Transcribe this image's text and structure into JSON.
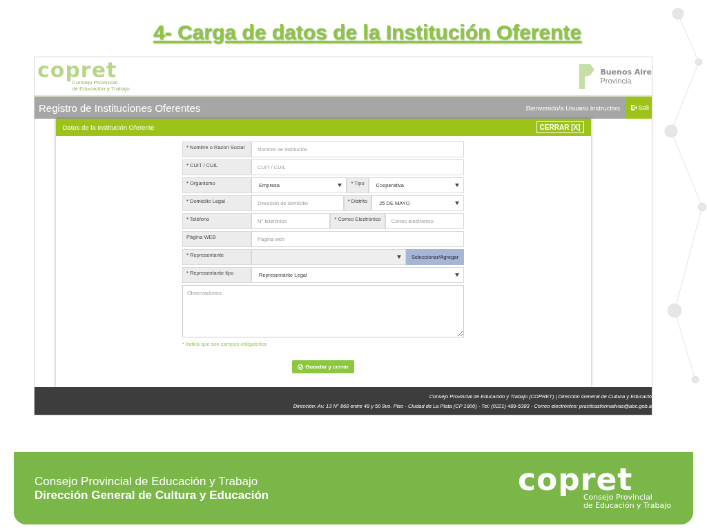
{
  "slide_title": "4- Carga de datos de la Institución Oferente",
  "app": {
    "logo": {
      "word": "copret",
      "line1": "Consejo Provincial",
      "line2": "de Educación y Trabajo"
    },
    "gov_logo": {
      "line1": "Buenos Aire",
      "line2": "Provincia"
    },
    "nav": {
      "title": "Registro de Instituciones Oferentes",
      "welcome": "Bienvenido/a Usuario Instructivo",
      "logout": "Sali"
    },
    "modal": {
      "title": "Datos de la Institución Oferente",
      "close": "CERRAR [X]",
      "rows": [
        {
          "items": [
            {
              "kind": "label",
              "text": "* Nombre o Razon Social"
            },
            {
              "kind": "input",
              "placeholder": "Nombre de institución"
            }
          ]
        },
        {
          "items": [
            {
              "kind": "label",
              "text": "* CUIT / CUIL"
            },
            {
              "kind": "input",
              "placeholder": "CUIT / CUIL"
            }
          ]
        },
        {
          "items": [
            {
              "kind": "label",
              "text": "* Organismo"
            },
            {
              "kind": "select",
              "value": "Empresa"
            },
            {
              "kind": "label",
              "text": "* Tipo"
            },
            {
              "kind": "select",
              "value": "Cooperativa"
            }
          ]
        },
        {
          "items": [
            {
              "kind": "label",
              "text": "* Domicilio Legal"
            },
            {
              "kind": "input",
              "placeholder": "Dirección de domicilio"
            },
            {
              "kind": "label",
              "text": "* Distrito"
            },
            {
              "kind": "select",
              "value": "25 DE MAYO"
            }
          ]
        },
        {
          "items": [
            {
              "kind": "label",
              "text": "* Teléfono"
            },
            {
              "kind": "input",
              "placeholder": "N° telefónico"
            },
            {
              "kind": "label",
              "text": "* Correo Electrónico"
            },
            {
              "kind": "input",
              "placeholder": "Correo electronico"
            }
          ]
        },
        {
          "items": [
            {
              "kind": "label",
              "text": "Página WEB"
            },
            {
              "kind": "input",
              "placeholder": "Pagina web"
            }
          ]
        },
        {
          "items": [
            {
              "kind": "label",
              "text": "* Representante"
            },
            {
              "kind": "select",
              "value": "",
              "disabled": true
            },
            {
              "kind": "button",
              "text": "Seleccionar/Agregar"
            }
          ]
        },
        {
          "items": [
            {
              "kind": "label",
              "text": "* Representante tipo"
            },
            {
              "kind": "select",
              "value": "Representante Legal"
            }
          ]
        },
        {
          "items": [
            {
              "kind": "textarea",
              "placeholder": "Observaciones"
            }
          ]
        }
      ],
      "note": "* Indica que son campos obligatorios",
      "save": "Guardar y cerrar"
    },
    "footer": {
      "line1": "Consejo Provincial de Educación y Trabajo (COPRET) | Dirección General de Cultura y Educació",
      "line2": "Dirección: Av. 13 N° 868 entre 49 y 50 8vo. Piso - Ciudad de La Plata (CP 1900) - Tel: (0221) 489-5383 - Correo electrónico: practicasformativas@abc.gob.a"
    }
  },
  "banner": {
    "line1": "Consejo Provincial de Educación y Trabajo",
    "line2": "Dirección General de Cultura y Educación",
    "logo": {
      "word": "copret",
      "line1": "Consejo Provincial",
      "line2": "de Educación y Trabajo"
    }
  }
}
